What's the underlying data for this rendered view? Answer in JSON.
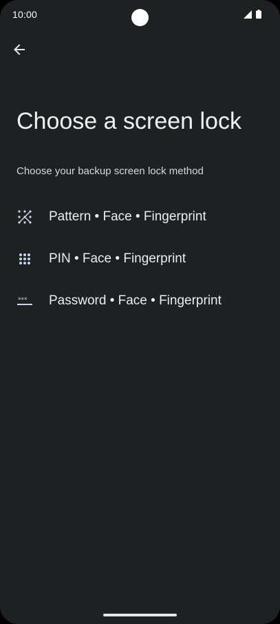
{
  "status_bar": {
    "time": "10:00"
  },
  "header": {
    "back_icon": "arrow-back-icon"
  },
  "main": {
    "title": "Choose a screen lock",
    "subtitle": "Choose your backup screen lock method",
    "options": [
      {
        "label": "Pattern • Face • Fingerprint",
        "icon": "pattern-icon"
      },
      {
        "label": "PIN • Face • Fingerprint",
        "icon": "pin-icon"
      },
      {
        "label": "Password • Face • Fingerprint",
        "icon": "password-icon"
      }
    ]
  },
  "colors": {
    "background": "#1f2022",
    "text": "#eceded",
    "icon": "#c8d7f0"
  }
}
